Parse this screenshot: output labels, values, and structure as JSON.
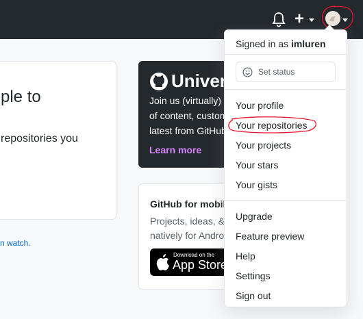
{
  "header": {
    "bell_icon": "bell-icon",
    "plus_label": "+",
    "avatar_icon": "user-avatar",
    "annotation_color": "#e8132b"
  },
  "left_card": {
    "heading": "ple to",
    "text": "repositories you",
    "watch_link": "n watch."
  },
  "universe_card": {
    "title": "Universe",
    "lines": [
      "Join us (virtually) f",
      "of content, custom",
      "latest from GitHub"
    ],
    "learn_more": "Learn more"
  },
  "mobile_card": {
    "title": "GitHub for mobile",
    "lines": [
      "Projects, ideas, & c",
      "natively for Androi"
    ],
    "appstore_small": "Download on the",
    "appstore_big": "App Store"
  },
  "dropdown": {
    "signed_in_prefix": "Signed in as",
    "username": "imluren",
    "set_status": "Set status",
    "section1": [
      "Your profile",
      "Your repositories",
      "Your projects",
      "Your stars",
      "Your gists"
    ],
    "section2": [
      "Upgrade",
      "Feature preview",
      "Help",
      "Settings",
      "Sign out"
    ]
  }
}
